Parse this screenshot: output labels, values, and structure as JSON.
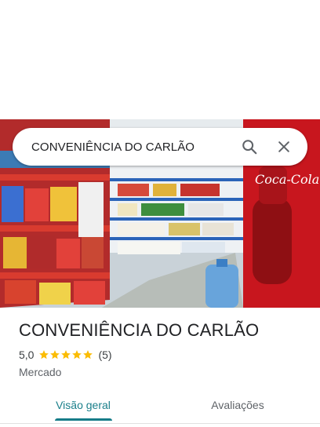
{
  "search": {
    "query": "CONVENIÊNCIA DO CARLÃO",
    "search_icon": "search-icon",
    "close_icon": "close-icon"
  },
  "photo": {
    "sign_text": "Coca-Cola"
  },
  "place": {
    "name": "CONVENIÊNCIA DO CARLÃO",
    "rating": "5,0",
    "stars": 5,
    "review_count": "(5)",
    "category": "Mercado"
  },
  "tabs": [
    {
      "label": "Visão geral",
      "active": true
    },
    {
      "label": "Avaliações",
      "active": false
    }
  ],
  "colors": {
    "accent": "#167c88",
    "star": "#fbbc04",
    "coca_red": "#d0161e"
  }
}
